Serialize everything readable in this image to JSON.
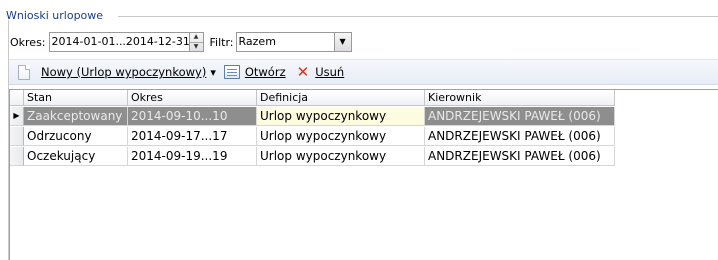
{
  "group_title": "Wnioski urlopowe",
  "filters": {
    "period_label": "Okres:",
    "period_value": "2014-01-01...2014-12-31",
    "filter_label": "Filtr:",
    "filter_value": "Razem"
  },
  "toolbar": {
    "new_label": "Nowy (Urlop wypoczynkowy)",
    "open_label": "Otwórz",
    "delete_label": "Usuń"
  },
  "grid": {
    "columns": [
      "Stan",
      "Okres",
      "Definicja",
      "Kierownik"
    ],
    "rows": [
      {
        "status": "Zaakceptowany",
        "period": "2014-09-10...10",
        "definition": "Urlop wypoczynkowy",
        "manager": "ANDRZEJEWSKI PAWEŁ (006)",
        "selected": true
      },
      {
        "status": "Odrzucony",
        "period": "2014-09-17...17",
        "definition": "Urlop wypoczynkowy",
        "manager": "ANDRZEJEWSKI PAWEŁ (006)",
        "selected": false
      },
      {
        "status": "Oczekujący",
        "period": "2014-09-19...19",
        "definition": "Urlop wypoczynkowy",
        "manager": "ANDRZEJEWSKI PAWEŁ (006)",
        "selected": false
      }
    ],
    "current_row_marker": "▶"
  },
  "icons": {
    "new": "new-document-icon",
    "open": "open-form-icon",
    "delete": "delete-x-icon",
    "spin_up": "▲",
    "spin_down": "▼",
    "combo_arrow": "▼",
    "new_dropdown": "▾"
  },
  "colors": {
    "title": "#1c3e84",
    "selected_row": "#8e8e8e",
    "focus_cell": "#fdfce0",
    "delete_icon": "#d9351f"
  }
}
